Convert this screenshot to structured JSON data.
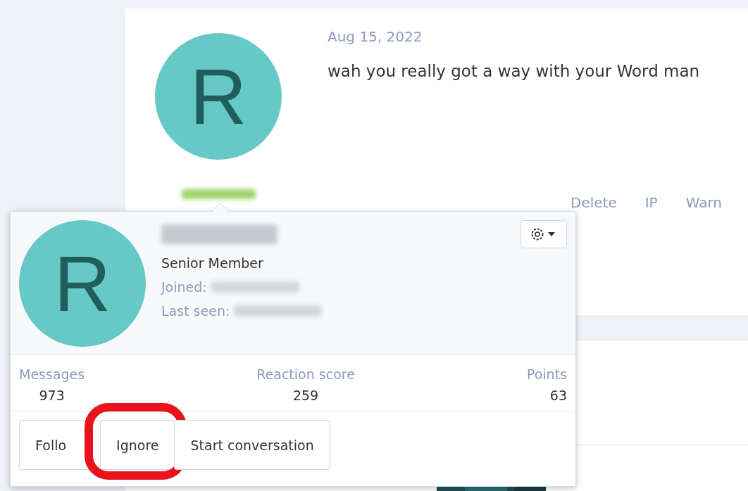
{
  "post": {
    "avatar_letter": "R",
    "date": "Aug 15, 2022",
    "message": "wah you really got a way with your Word man",
    "actions": [
      "Delete",
      "IP",
      "Warn"
    ]
  },
  "member_card": {
    "avatar_letter": "R",
    "title": "Senior Member",
    "joined_label": "Joined:",
    "last_seen_label": "Last seen:",
    "stats": [
      {
        "label": "Messages",
        "value": "973"
      },
      {
        "label": "Reaction score",
        "value": "259"
      },
      {
        "label": "Points",
        "value": "63"
      }
    ],
    "buttons": [
      {
        "label": "Follo",
        "highlighted": false
      },
      {
        "label": "Ignore",
        "highlighted": true
      },
      {
        "label": "Start conversation",
        "highlighted": false
      }
    ]
  }
}
